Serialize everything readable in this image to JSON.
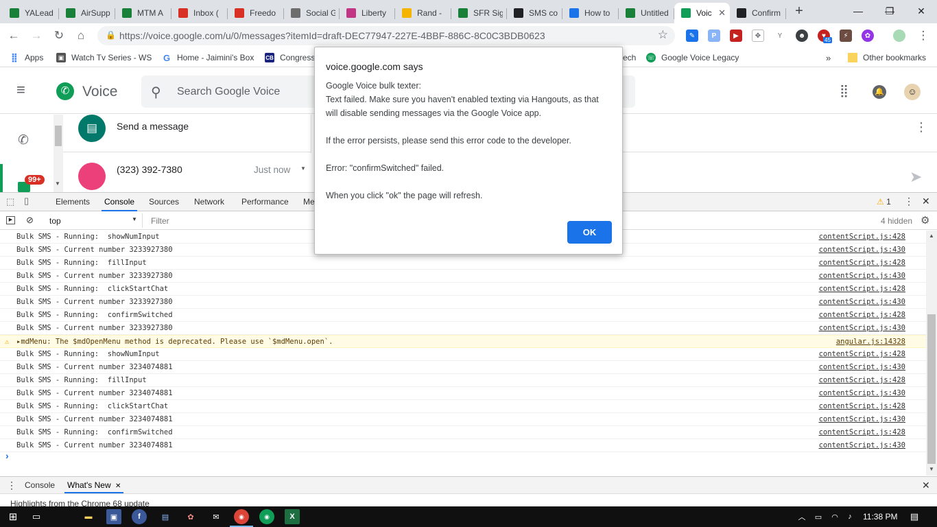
{
  "browser": {
    "tabs": [
      {
        "label": "YALead",
        "icon": "sheets-icon",
        "color": "#188038"
      },
      {
        "label": "AirSupp",
        "icon": "sheets-icon",
        "color": "#188038"
      },
      {
        "label": "MTM A",
        "icon": "sheets-icon",
        "color": "#188038"
      },
      {
        "label": "Inbox (",
        "icon": "gmail-icon",
        "color": "#d93025"
      },
      {
        "label": "Freedo",
        "icon": "gmail-icon",
        "color": "#d93025"
      },
      {
        "label": "Social G",
        "icon": "bolt-icon",
        "color": "#6d6d6d"
      },
      {
        "label": "Liberty",
        "icon": "instagram-icon",
        "color": "#c13584"
      },
      {
        "label": "Rand -",
        "icon": "drive-icon",
        "color": "#f4b400"
      },
      {
        "label": "SFR Sig",
        "icon": "sheets-icon",
        "color": "#188038"
      },
      {
        "label": "SMS co",
        "icon": "mail-icon",
        "color": "#202124"
      },
      {
        "label": "How to",
        "icon": "checkmark-icon",
        "color": "#1a73e8"
      },
      {
        "label": "Untitled",
        "icon": "sheets-icon",
        "color": "#188038"
      },
      {
        "label": "Voic",
        "icon": "voice-icon",
        "color": "#0f9d58",
        "active": true
      },
      {
        "label": "Confirm",
        "icon": "github-icon",
        "color": "#202124"
      }
    ],
    "new_tab_glyph": "+",
    "window_controls": {
      "minimize": "—",
      "maximize": "❐",
      "close": "✕"
    },
    "url": "https://voice.google.com/u/0/messages?itemId=draft-DEC77947-227E-4BBF-886C-8C0C3BDB0623",
    "extension_badge": "45",
    "bookmarks": [
      {
        "label": "Apps",
        "icon": "apps-icon"
      },
      {
        "label": "Watch Tv Series - WS",
        "icon": "tv-icon"
      },
      {
        "label": "Home - Jaimini's Box",
        "icon": "google-icon"
      },
      {
        "label": "Congress",
        "icon": "cb-icon"
      },
      {
        "label": "ech",
        "icon": ""
      },
      {
        "label": "Google Voice Legacy",
        "icon": "voice-icon"
      }
    ],
    "bookmarks_more": "»",
    "other_bookmarks": "Other bookmarks"
  },
  "voice": {
    "app_name": "Voice",
    "search_placeholder": "Search Google Voice",
    "send_message": "Send a message",
    "contact_number": "(323) 392-7380",
    "contact_time": "Just now",
    "unread_badge": "99+"
  },
  "devtools": {
    "tabs": [
      "Elements",
      "Console",
      "Sources",
      "Network",
      "Performance",
      "Me"
    ],
    "active_tab": "Console",
    "warning_count": "1",
    "context": "top",
    "filter_placeholder": "Filter",
    "hidden_count": "4 hidden",
    "lines": [
      {
        "msg": "Bulk SMS - Running:  showNumInput",
        "src": "contentScript.js:428"
      },
      {
        "msg": "Bulk SMS - Current number 3233927380",
        "src": "contentScript.js:430"
      },
      {
        "msg": "Bulk SMS - Running:  fillInput",
        "src": "contentScript.js:428"
      },
      {
        "msg": "Bulk SMS - Current number 3233927380",
        "src": "contentScript.js:430"
      },
      {
        "msg": "Bulk SMS - Running:  clickStartChat",
        "src": "contentScript.js:428"
      },
      {
        "msg": "Bulk SMS - Current number 3233927380",
        "src": "contentScript.js:430"
      },
      {
        "msg": "Bulk SMS - Running:  confirmSwitched",
        "src": "contentScript.js:428"
      },
      {
        "msg": "Bulk SMS - Current number 3233927380",
        "src": "contentScript.js:430"
      },
      {
        "msg": "▸mdMenu: The $mdOpenMenu method is deprecated. Please use `$mdMenu.open`.",
        "src": "angular.js:14328",
        "level": "warning"
      },
      {
        "msg": "Bulk SMS - Running:  showNumInput",
        "src": "contentScript.js:428"
      },
      {
        "msg": "Bulk SMS - Current number 3234074881",
        "src": "contentScript.js:430"
      },
      {
        "msg": "Bulk SMS - Running:  fillInput",
        "src": "contentScript.js:428"
      },
      {
        "msg": "Bulk SMS - Current number 3234074881",
        "src": "contentScript.js:430"
      },
      {
        "msg": "Bulk SMS - Running:  clickStartChat",
        "src": "contentScript.js:428"
      },
      {
        "msg": "Bulk SMS - Current number 3234074881",
        "src": "contentScript.js:430"
      },
      {
        "msg": "Bulk SMS - Running:  confirmSwitched",
        "src": "contentScript.js:428"
      },
      {
        "msg": "Bulk SMS - Current number 3234074881",
        "src": "contentScript.js:430"
      }
    ],
    "prompt": "›",
    "drawer_tabs": [
      "Console",
      "What's New"
    ],
    "drawer_highlight": "Highlights from the Chrome 68 update"
  },
  "dialog": {
    "title": "voice.google.com says",
    "lines": [
      "Google Voice bulk texter:",
      "Text failed. Make sure you haven't enabled texting via Hangouts, as that",
      "will disable sending messages via the Google Voice app.",
      "",
      "If the error persists, please send this error code to the developer.",
      "",
      "Error: \"confirmSwitched\" failed.",
      "",
      "When you click \"ok\" the page will refresh."
    ],
    "ok_label": "OK"
  },
  "taskbar": {
    "time": "11:38 PM"
  }
}
